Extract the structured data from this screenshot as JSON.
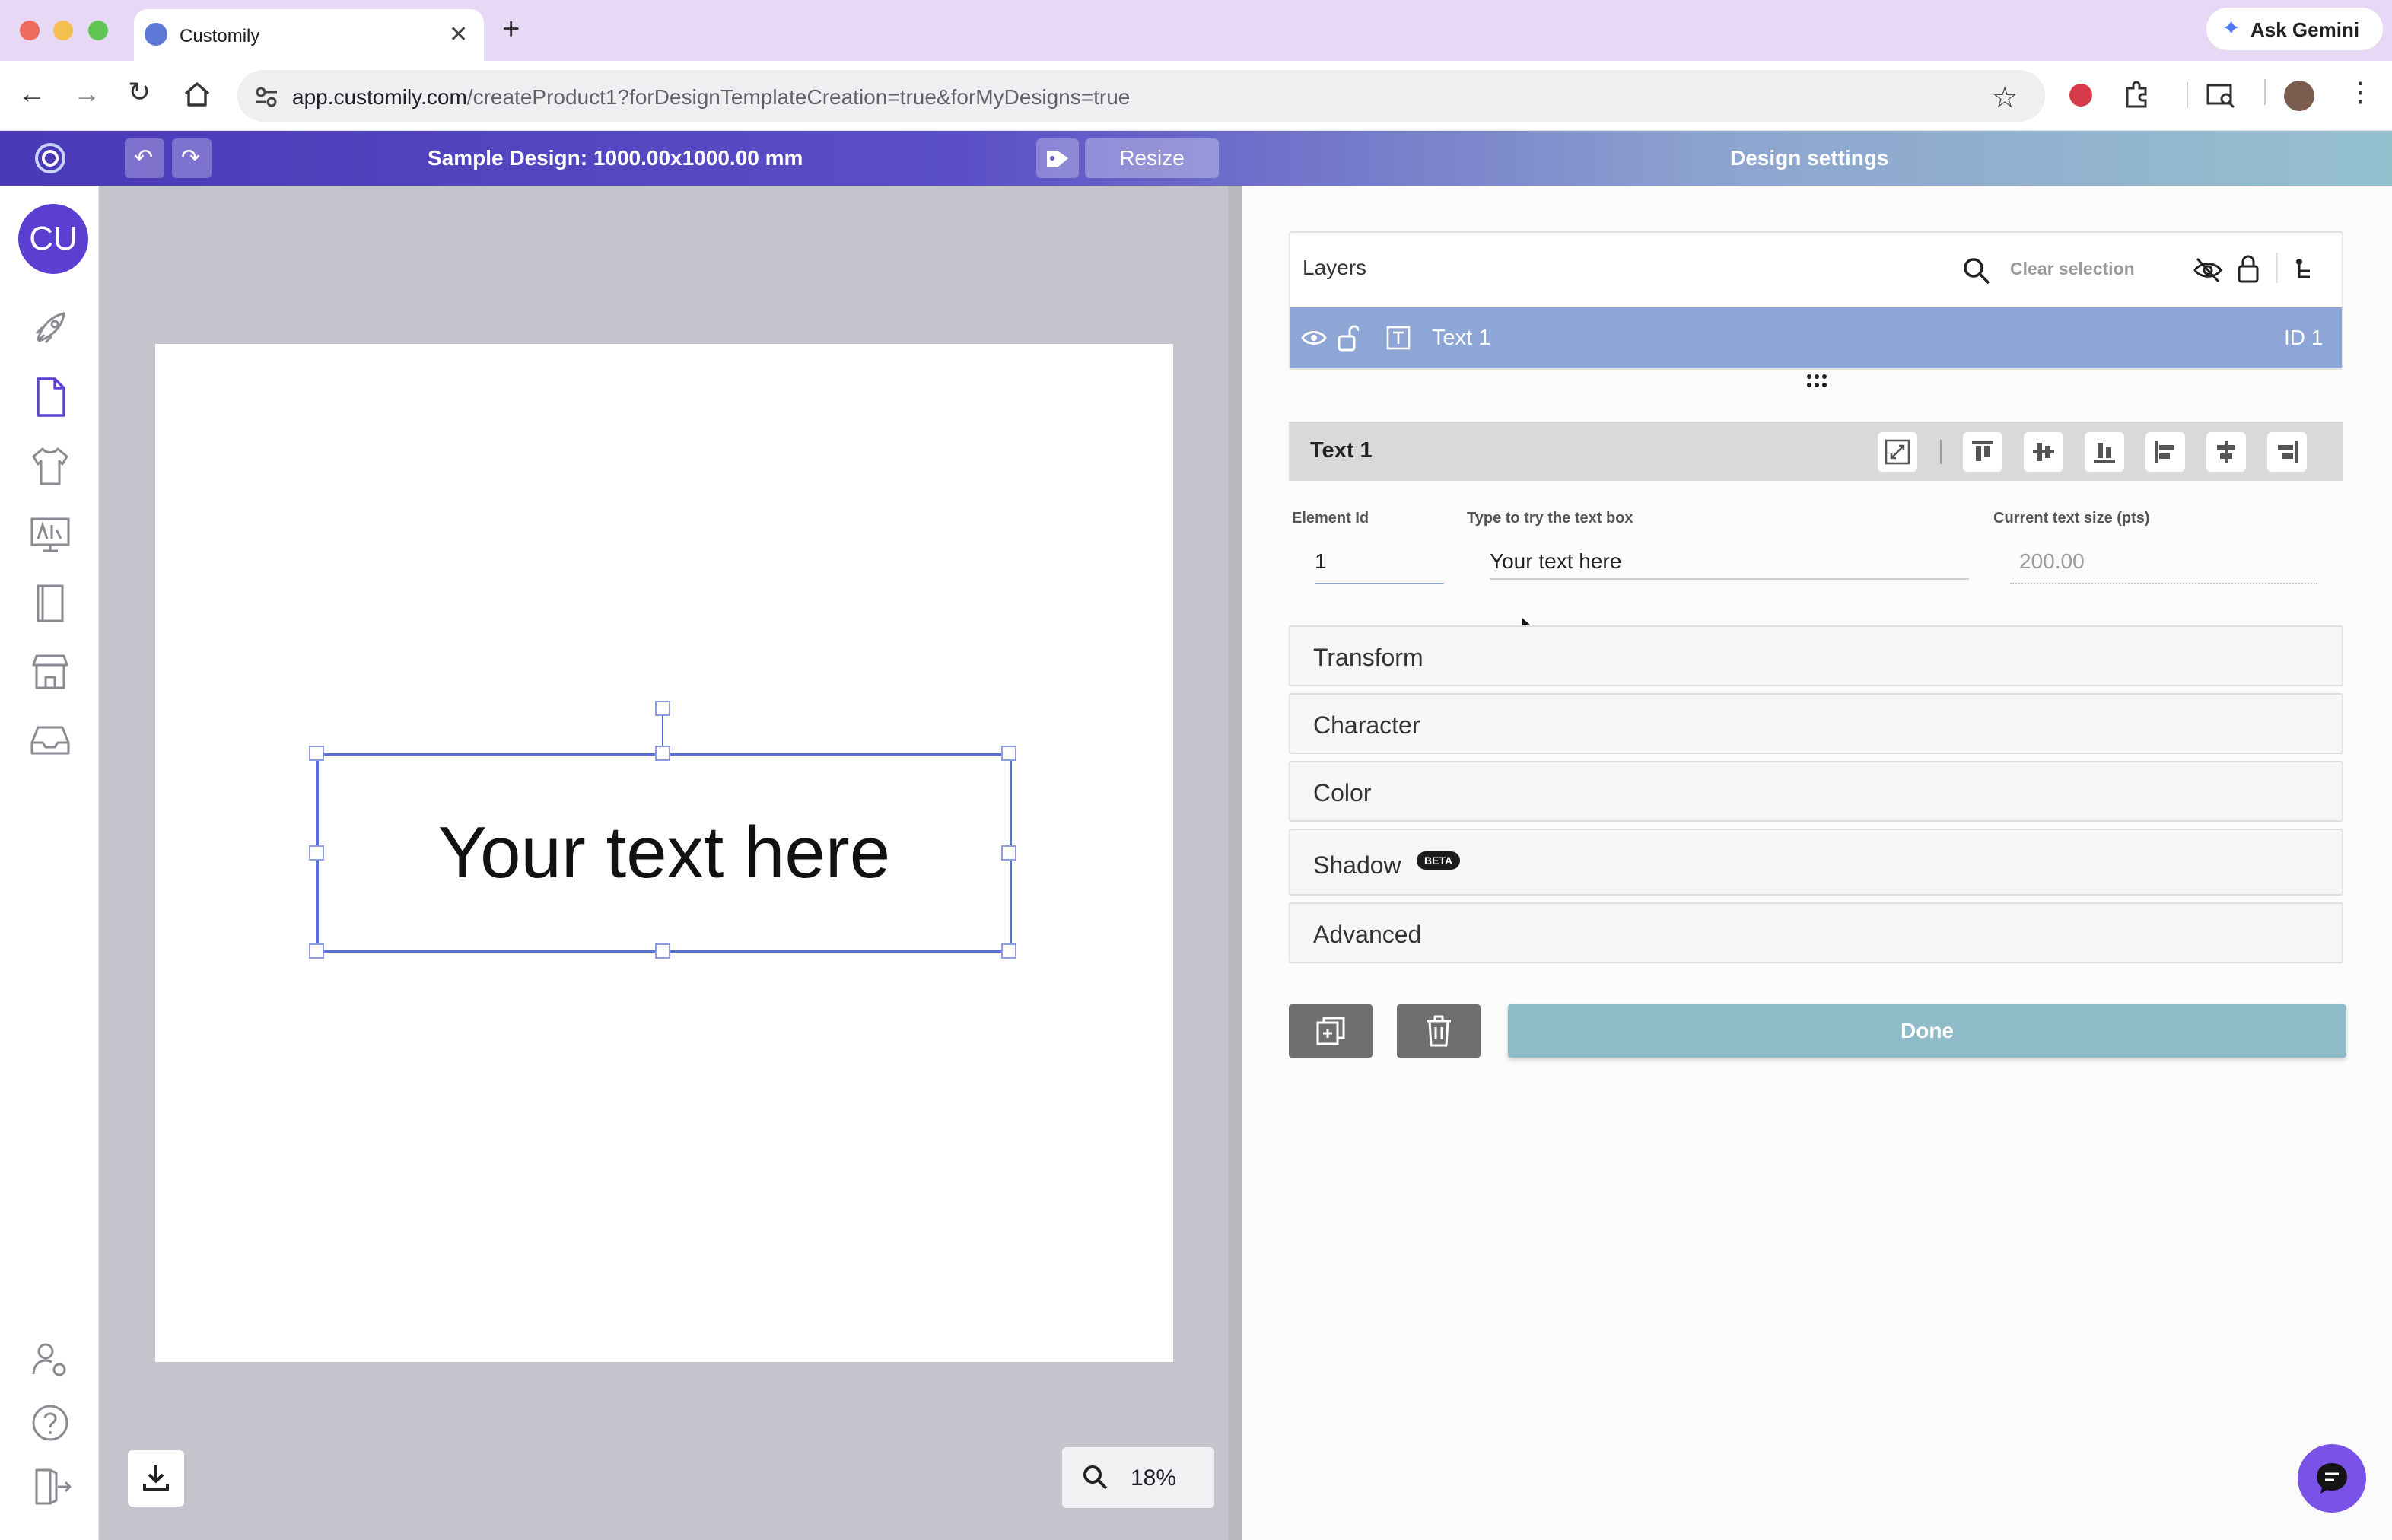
{
  "browser": {
    "tab_title": "Customily",
    "url_domain": "app.customily.com",
    "url_path": "/createProduct1?forDesignTemplateCreation=true&forMyDesigns=true",
    "gemini_label": "Ask Gemini"
  },
  "app": {
    "design_title": "Sample Design: 1000.00x1000.00 mm",
    "resize_label": "Resize",
    "settings_title": "Design settings",
    "user_initials": "CU",
    "canvas_text": "Your text here",
    "zoom_level": "18%"
  },
  "layers": {
    "title": "Layers",
    "clear_selection": "Clear selection",
    "items": [
      {
        "name": "Text 1",
        "id_label": "ID 1"
      }
    ]
  },
  "element": {
    "title": "Text 1",
    "fields": {
      "element_id": {
        "label": "Element Id",
        "value": "1"
      },
      "text_box": {
        "label": "Type to try the text box",
        "value": "Your text here"
      },
      "text_size": {
        "label": "Current text size (pts)",
        "value": "200.00"
      }
    },
    "sections": [
      "Transform",
      "Character",
      "Color",
      "Shadow",
      "Advanced"
    ],
    "beta_badge": "BETA",
    "done_label": "Done"
  },
  "colors": {
    "accent_purple": "#5b3fd1",
    "layer_selected": "#8da6d6",
    "done_button": "#8fbac8"
  }
}
